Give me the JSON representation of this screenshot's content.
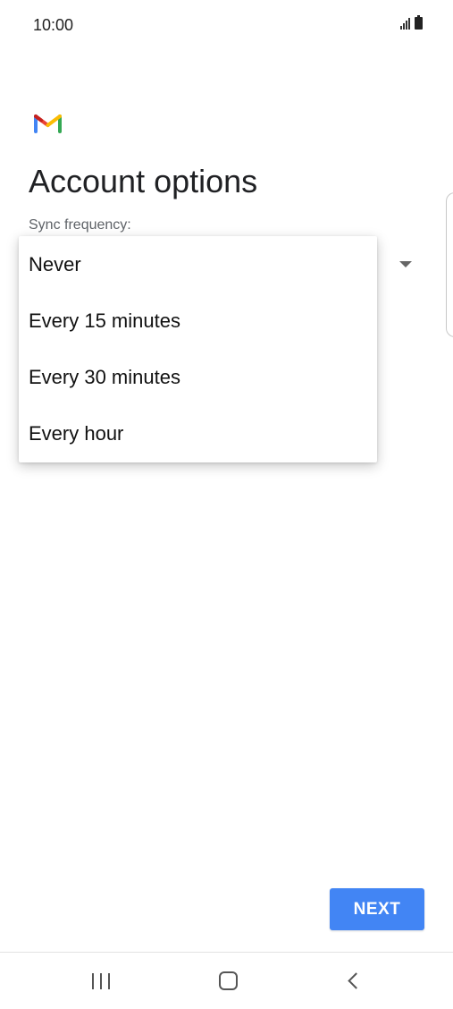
{
  "status_bar": {
    "time": "10:00",
    "signal_icon": "signal-icon",
    "battery_icon": "battery-icon"
  },
  "app": {
    "logo_icon": "gmail-logo-icon",
    "title": "Account options",
    "sync_label": "Sync frequency:"
  },
  "dropdown": {
    "arrow_icon": "dropdown-arrow-icon",
    "options": [
      {
        "label": "Never"
      },
      {
        "label": "Every 15 minutes"
      },
      {
        "label": "Every 30 minutes"
      },
      {
        "label": "Every hour"
      }
    ]
  },
  "footer": {
    "next_label": "NEXT",
    "next_color": "#4285f4"
  },
  "nav": {
    "recents_icon": "recents-icon",
    "home_icon": "home-icon",
    "back_icon": "back-icon"
  }
}
